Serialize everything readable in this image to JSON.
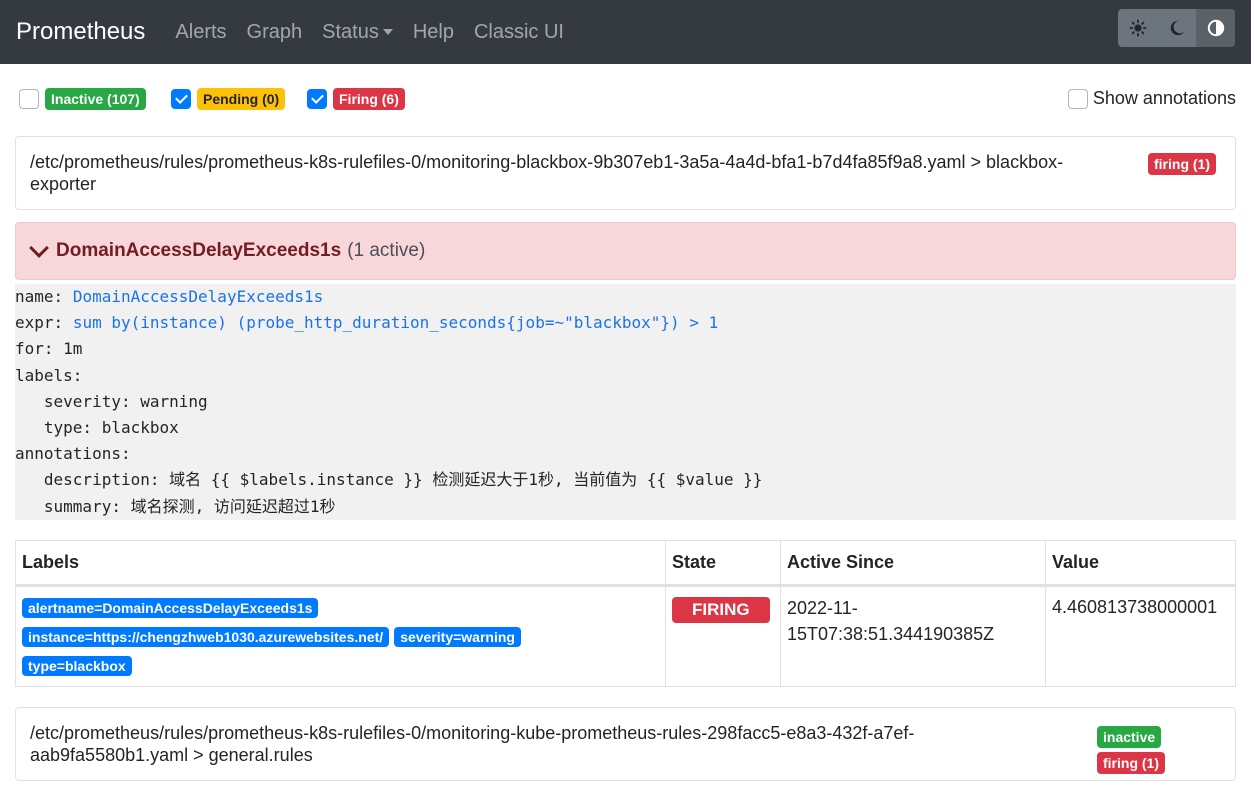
{
  "nav": {
    "brand": "Prometheus",
    "items": [
      "Alerts",
      "Graph",
      "Status",
      "Help",
      "Classic UI"
    ]
  },
  "theme_buttons": [
    "light-icon",
    "moon-icon",
    "contrast-icon"
  ],
  "filters": {
    "inactive": "Inactive (107)",
    "pending": "Pending (0)",
    "firing": "Firing (6)",
    "show_annotations": "Show annotations"
  },
  "group1": {
    "path": "/etc/prometheus/rules/prometheus-k8s-rulefiles-0/monitoring-blackbox-9b307eb1-3a5a-4a4d-bfa1-b7d4fa85f9a8.yaml > blackbox-exporter",
    "badge": "firing (1)"
  },
  "alert": {
    "name": "DomainAccessDelayExceeds1s",
    "active": "(1 active)"
  },
  "rule": {
    "name_key": "name:",
    "name_val": "DomainAccessDelayExceeds1s",
    "expr_key": "expr:",
    "expr_val": "sum by(instance) (probe_http_duration_seconds{job=~\"blackbox\"}) > 1",
    "for_line": "for: 1m",
    "labels_key": "labels:",
    "severity_line": "   severity: warning",
    "type_line": "   type: blackbox",
    "annotations_key": "annotations:",
    "description_line": "   description: 域名 {{ $labels.instance }} 检测延迟大于1秒, 当前值为 {{ $value }}",
    "summary_line": "   summary: 域名探测, 访问延迟超过1秒"
  },
  "table": {
    "headers": [
      "Labels",
      "State",
      "Active Since",
      "Value"
    ],
    "labels": [
      "alertname=DomainAccessDelayExceeds1s",
      "instance=https://chengzhweb1030.azurewebsites.net/",
      "severity=warning",
      "type=blackbox"
    ],
    "state": "FIRING",
    "active_since_1": "2022-11-",
    "active_since_2": "15T07:38:51.344190385Z",
    "value": "4.460813738000001"
  },
  "group2": {
    "path": "/etc/prometheus/rules/prometheus-k8s-rulefiles-0/monitoring-kube-prometheus-rules-298facc5-e8a3-432f-a7ef-aab9fa5580b1.yaml > general.rules",
    "badge_inactive": "inactive",
    "badge_firing": "firing (1)"
  },
  "colors": {
    "navbar": "#343a40",
    "firing": "#dc3545",
    "pending": "#ffc107",
    "inactive": "#28a745",
    "label": "#007bff"
  }
}
